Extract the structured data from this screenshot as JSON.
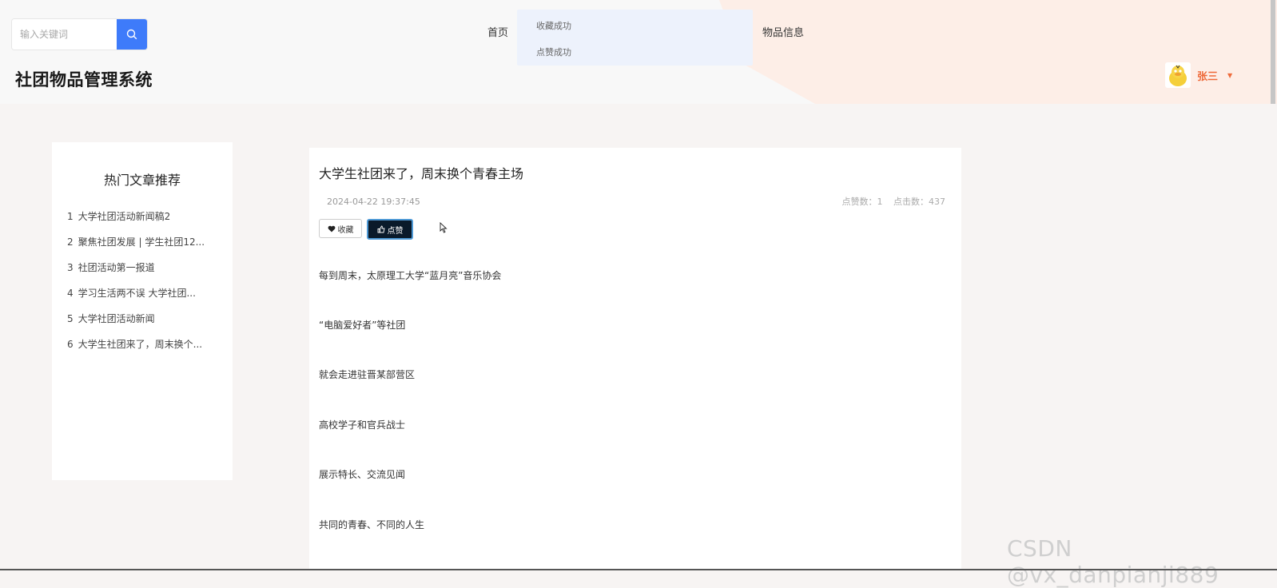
{
  "search": {
    "placeholder": "输入关键词"
  },
  "site": {
    "title": "社团物品管理系统"
  },
  "nav": {
    "items": [
      {
        "label": "首页"
      },
      {
        "label": "物品信息"
      }
    ]
  },
  "toast": {
    "messages": [
      "收藏成功",
      "点赞成功"
    ]
  },
  "user": {
    "name": "张三",
    "avatar": "duck-avatar-icon"
  },
  "sidebar": {
    "title": "热门文章推荐",
    "items": [
      {
        "num": "1",
        "label": "大学社团活动新闻稿2"
      },
      {
        "num": "2",
        "label": "聚焦社团发展 | 学生社团12..."
      },
      {
        "num": "3",
        "label": "社团活动第一报道"
      },
      {
        "num": "4",
        "label": "学习生活两不误 大学社团..."
      },
      {
        "num": "5",
        "label": "大学社团活动新闻"
      },
      {
        "num": "6",
        "label": "大学生社团来了，周末换个..."
      }
    ]
  },
  "article": {
    "title": "大学生社团来了，周末换个青春主场",
    "date": "2024-04-22 19:37:45",
    "likes_label": "点赞数：1",
    "clicks_label": "点击数：437",
    "fav_label": "收藏",
    "like_label": "点赞",
    "paragraphs": [
      "每到周末，太原理工大学“蓝月亮”音乐协会",
      "“电脑爱好者”等社团",
      "就会走进驻晋某部营区",
      "高校学子和官兵战士",
      "展示特长、交流见闻",
      "共同的青春、不同的人生"
    ]
  },
  "watermark": "CSDN @vx_danpianji889",
  "colors": {
    "accent": "#3e7bfa",
    "user": "#ee6b3b",
    "like_btn": "#0a1a2a"
  }
}
